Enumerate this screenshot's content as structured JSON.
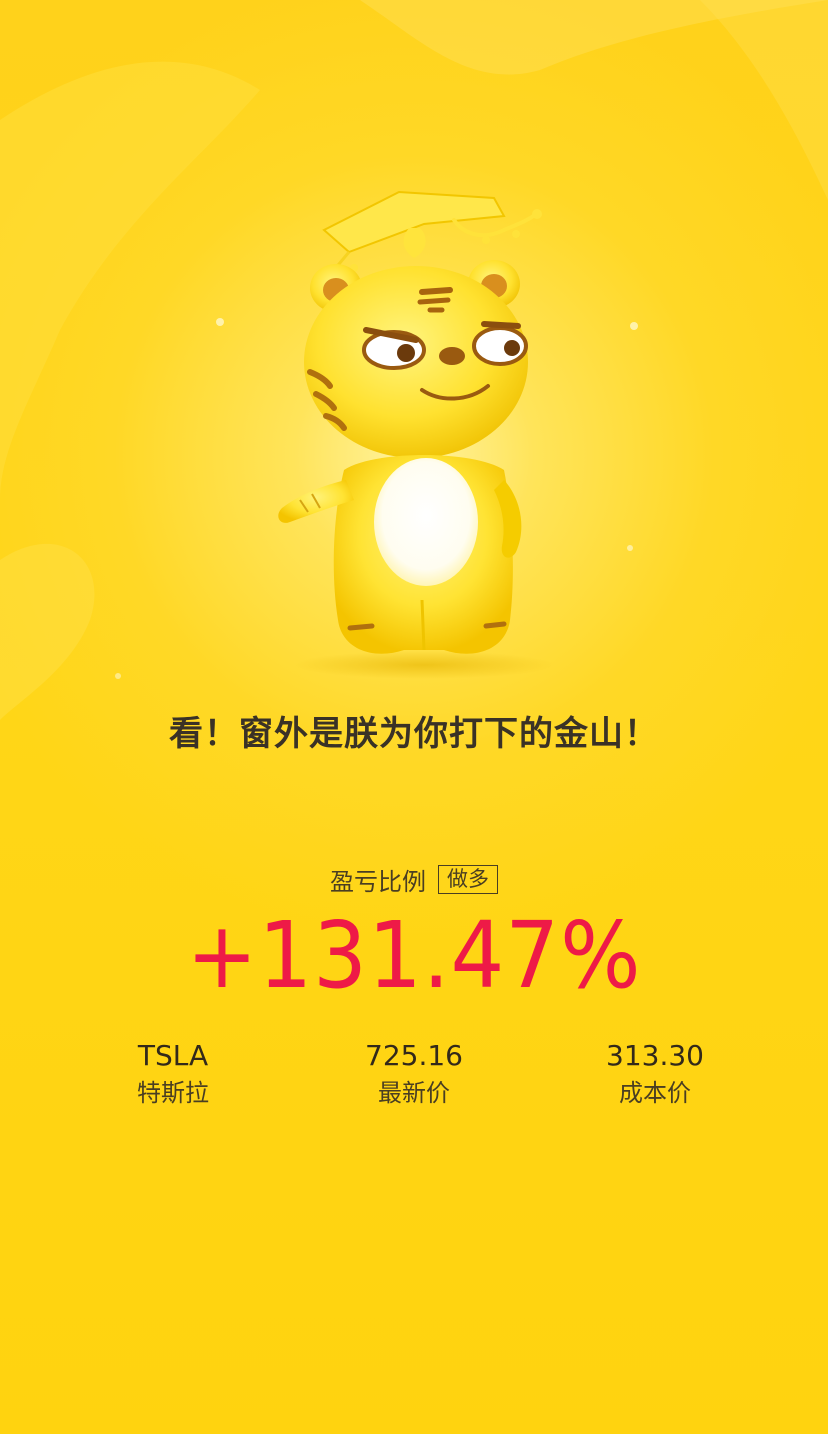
{
  "slogan": "看！窗外是朕为你打下的金山！",
  "pnl": {
    "label": "盈亏比例",
    "direction": "做多",
    "value": "+131.47%",
    "color": "#EE1A47"
  },
  "stock": {
    "symbol": "TSLA",
    "name": "特斯拉",
    "latest_price": "725.16",
    "latest_price_label": "最新价",
    "cost_price": "313.30",
    "cost_price_label": "成本价"
  },
  "background_color": "#FFD314",
  "mascot": "tiger-mascot-with-crown"
}
